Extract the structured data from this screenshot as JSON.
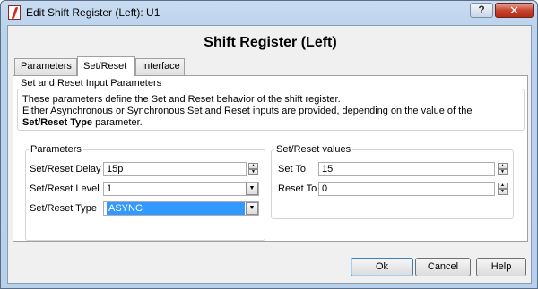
{
  "window": {
    "title": "Edit Shift Register (Left): U1",
    "help_label": "?",
    "close_label": "✕"
  },
  "heading": "Shift Register (Left)",
  "tabs": [
    {
      "label": "Parameters",
      "active": false
    },
    {
      "label": "Set/Reset",
      "active": true
    },
    {
      "label": "Interface",
      "active": false
    }
  ],
  "input_params": {
    "title": "Set and Reset Input Parameters",
    "line1": "These parameters define the Set and Reset behavior of the shift register.",
    "line2_prefix": "Either Asynchronous or Synchronous Set and Reset inputs are provided, depending on the value of the ",
    "line2_bold": "Set/Reset Type",
    "line2_suffix": " parameter."
  },
  "parameters": {
    "title": "Parameters",
    "delay_label": "Set/Reset Delay",
    "delay_value": "15p",
    "level_label": "Set/Reset Level",
    "level_value": "1",
    "type_label": "Set/Reset Type",
    "type_value": "ASYNC"
  },
  "values": {
    "title": "Set/Reset values",
    "set_to_label": "Set To",
    "set_to_value": "15",
    "reset_to_label": "Reset To",
    "reset_to_value": "0"
  },
  "buttons": {
    "ok": "Ok",
    "cancel": "Cancel",
    "help": "Help"
  },
  "icons": {
    "spin_up": "▲",
    "spin_down": "▼",
    "dropdown": "▼"
  }
}
